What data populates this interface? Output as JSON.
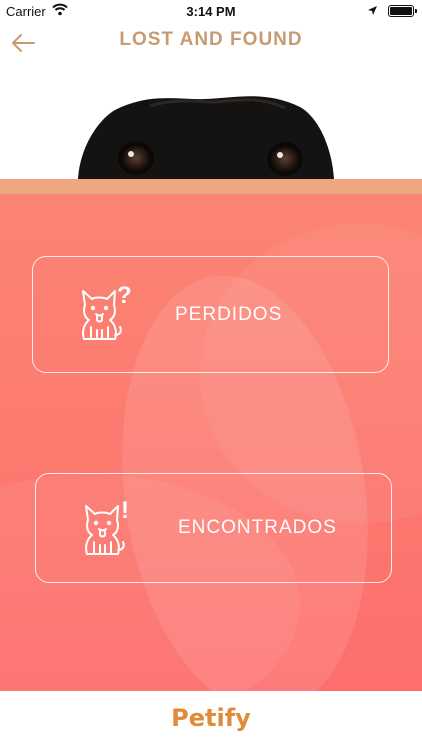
{
  "status_bar": {
    "carrier": "Carrier",
    "time": "3:14 PM"
  },
  "nav": {
    "title": "LOST AND FOUND"
  },
  "options": [
    {
      "label": "PERDIDOS",
      "icon": "dog-question-icon"
    },
    {
      "label": "ENCONTRADOS",
      "icon": "dog-exclamation-icon"
    }
  ],
  "footer": {
    "brand": "Petify"
  },
  "colors": {
    "title": "#c89a72",
    "stripe": "#eea880",
    "panel_top": "#fb8574",
    "panel_bottom": "#fd6e6c",
    "brand": "#e08a3c"
  }
}
